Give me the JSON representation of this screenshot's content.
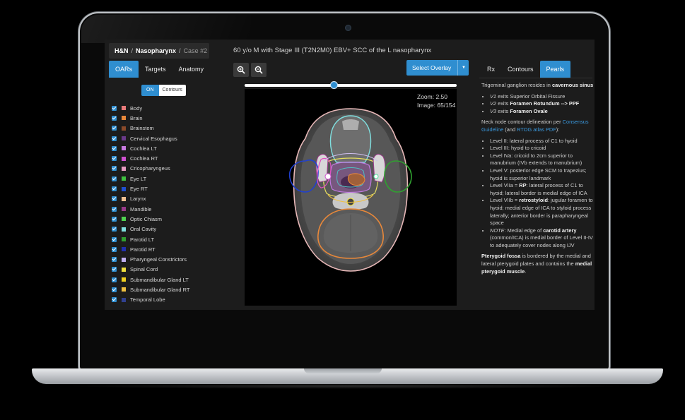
{
  "breadcrumb": {
    "part1": "H&N",
    "sep1": "/",
    "part2": "Nasopharynx",
    "sep2": "/",
    "part3": "Case #2"
  },
  "left_tabs": [
    {
      "label": "OARs"
    },
    {
      "label": "Targets"
    },
    {
      "label": "Anatomy"
    }
  ],
  "toggle": {
    "on_label": "ON",
    "off_label": "Contours"
  },
  "structures": [
    {
      "label": "Body",
      "color": "#e87a7a"
    },
    {
      "label": "Brain",
      "color": "#e8883a"
    },
    {
      "label": "Brainstem",
      "color": "#8b4a2a"
    },
    {
      "label": "Cervical Esophagus",
      "color": "#6a3a8a"
    },
    {
      "label": "Cochlea LT",
      "color": "#c87ae0"
    },
    {
      "label": "Cochlea RT",
      "color": "#d050d0"
    },
    {
      "label": "Cricopharyngeus",
      "color": "#e89ac0"
    },
    {
      "label": "Eye LT",
      "color": "#40c040"
    },
    {
      "label": "Eye RT",
      "color": "#2050d0"
    },
    {
      "label": "Larynx",
      "color": "#f0c090"
    },
    {
      "label": "Mandible",
      "color": "#9a3a8a"
    },
    {
      "label": "Optic Chiasm",
      "color": "#50d050"
    },
    {
      "label": "Oral Cavity",
      "color": "#80e0e0"
    },
    {
      "label": "Parotid LT",
      "color": "#30a030"
    },
    {
      "label": "Parotid RT",
      "color": "#2030b0"
    },
    {
      "label": "Pharyngeal Constrictors",
      "color": "#c0b0f0"
    },
    {
      "label": "Spinal Cord",
      "color": "#f0e040"
    },
    {
      "label": "Submandibular Gland LT",
      "color": "#f0d020"
    },
    {
      "label": "Submandibular Gland RT",
      "color": "#f0c040"
    },
    {
      "label": "Temporal Lobe",
      "color": "#304090"
    }
  ],
  "case_title": "60 y/o M with Stage III (T2N2M0) EBV+ SCC of the L nasopharynx",
  "overlay_button": {
    "label": "Select Overlay"
  },
  "viewer": {
    "zoom_text": "Zoom: 2.50",
    "image_text": "Image: 65/154",
    "slider_value": 65,
    "slider_max": 154
  },
  "right_tabs": [
    {
      "label": "Rx"
    },
    {
      "label": "Contours"
    },
    {
      "label": "Pearls"
    }
  ],
  "pearls": {
    "p1_a": "Trigeminal ganglion resides in ",
    "p1_b": "cavernous sinus",
    "v1_a": "V1",
    "v1_b": " exits Superior Orbital Fissure",
    "v2_a": "V2",
    "v2_b": " exits ",
    "v2_c": "Foramen Rotundum --> PPF",
    "v3_a": "V3",
    "v3_b": " exits ",
    "v3_c": "Foramen Ovale",
    "p2_a": "Neck node contour delineation per ",
    "p2_link1": "Consensus Guideline",
    "p2_b": " (and ",
    "p2_link2": "RTOG atlas PDF",
    "p2_c": "):",
    "l1": "Level II: lateral process of C1 to hyoid",
    "l2": "Level III: hyoid to cricoid",
    "l3": "Level IVa: cricoid to 2cm superior to manubrium (IVb extends to manubrium)",
    "l4": "Level V: posterior edge SCM to trapezius; hyoid is superior landmark",
    "l5_a": "Level VIIa = ",
    "l5_b": "RP",
    "l5_c": ": lateral process of C1 to hyoid; lateral border is medial edge of ICA",
    "l6_a": "Level VIIb = ",
    "l6_b": "retrostyloid",
    "l6_c": ": jugular foramen to hyoid; medial edge of ICA to styloid process laterally; anterior border is parapharyngeal space",
    "l7_a": "NOTE",
    "l7_b": ": Medial edge of ",
    "l7_c": "carotid artery",
    "l7_d": " (common/ICA) is medial border of Level II-IV to adequately cover nodes along IJV",
    "p3_a": "Pterygoid fossa",
    "p3_b": " is bordered by the medial and lateral pterygoid plates and contains the ",
    "p3_c": "medial pterygoid muscle",
    "p3_d": "."
  }
}
